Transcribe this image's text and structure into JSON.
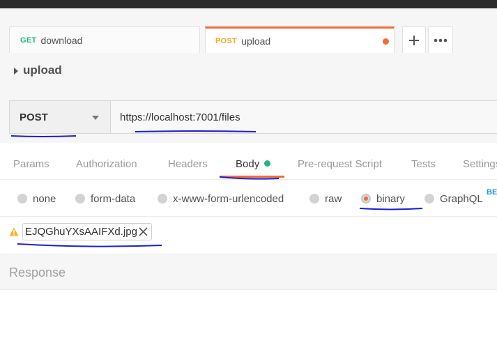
{
  "tabs": [
    {
      "method": "GET",
      "name": "download",
      "method_color": "#26b47f"
    },
    {
      "method": "POST",
      "name": "upload",
      "method_color": "#f5a623",
      "unsaved": true
    }
  ],
  "tab_actions": {
    "new_tab": "plus-icon",
    "more": "ellipsis-icon"
  },
  "request": {
    "title": "upload",
    "method": "POST",
    "url": "https://localhost:7001/files"
  },
  "request_tabs": [
    "Params",
    "Authorization",
    "Headers",
    "Body",
    "Pre-request Script",
    "Tests",
    "Settings"
  ],
  "active_request_tab": "Body",
  "body_types": [
    "none",
    "form-data",
    "x-www-form-urlencoded",
    "raw",
    "binary",
    "GraphQL"
  ],
  "selected_body_type": "binary",
  "graphql_badge": "BETA",
  "file": {
    "name": "EJQGhuYXsAAIFXd.jpg",
    "warning_icon": "warning-icon"
  },
  "response": {
    "label": "Response"
  },
  "colors": {
    "accent": "#f26b3a",
    "green": "#26b47f",
    "annotation": "#1c1cd8"
  }
}
